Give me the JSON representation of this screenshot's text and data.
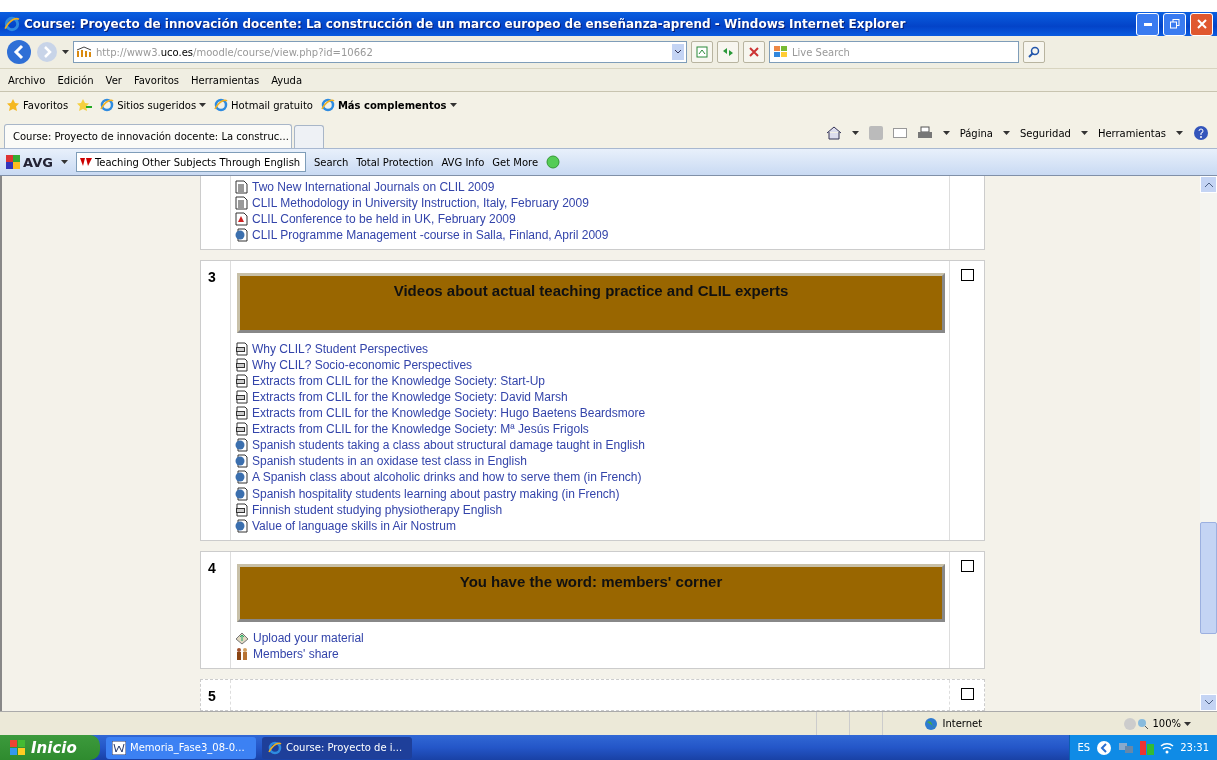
{
  "window": {
    "title": "Course: Proyecto de innovación docente: La construcción de un marco europeo de enseñanza-aprend - Windows Internet Explorer"
  },
  "address": {
    "url": "http://www3.**uco.es**/moodle/course/view.php?id=10662"
  },
  "search": {
    "placeholder": "Live Search"
  },
  "menu": [
    "Archivo",
    "Edición",
    "Ver",
    "Favoritos",
    "Herramientas",
    "Ayuda"
  ],
  "favorites_bar": {
    "label": "Favoritos",
    "items": [
      {
        "label": "Sitios sugeridos",
        "dropdown": true,
        "bold": false
      },
      {
        "label": "Hotmail gratuito",
        "dropdown": false,
        "bold": false
      },
      {
        "label": "Más complementos",
        "dropdown": true,
        "bold": true
      }
    ]
  },
  "tab": {
    "label": "Course: Proyecto de innovación docente: La construc...",
    "selected": true
  },
  "command_bar": [
    "Página",
    "Seguridad",
    "Herramientas"
  ],
  "avg_toolbar": {
    "brand": "AVG",
    "query": "Teaching Other Subjects Through English",
    "items": [
      "Search",
      "Total Protection",
      "AVG Info",
      "Get More"
    ]
  },
  "sections": [
    {
      "links": [
        {
          "text": "Two New International Journals on CLIL 2009",
          "kind": "document"
        },
        {
          "text": "CLIL Methodology in University Instruction, Italy, February 2009",
          "kind": "document"
        },
        {
          "text": "CLIL Conference to be held in UK, February 2009",
          "kind": "pdf"
        },
        {
          "text": "CLIL Programme Management -course in Salla, Finland, April 2009",
          "kind": "web"
        }
      ]
    },
    {
      "number": "3",
      "title": "Videos about actual teaching practice and CLIL experts",
      "checked": false,
      "links": [
        {
          "text": "Why CLIL? Student Perspectives",
          "kind": "video"
        },
        {
          "text": "Why CLIL? Socio-economic Perspectives",
          "kind": "video"
        },
        {
          "text": "Extracts from CLIL for the Knowledge Society: Start-Up",
          "kind": "video"
        },
        {
          "text": "Extracts from CLIL for the Knowledge Society: David Marsh",
          "kind": "video"
        },
        {
          "text": "Extracts from CLIL for the Knowledge Society: Hugo Baetens Beardsmore",
          "kind": "video"
        },
        {
          "text": "Extracts from CLIL for the Knowledge Society: Mª Jesús Frigols",
          "kind": "video"
        },
        {
          "text": "Spanish students taking a class about structural damage taught in English",
          "kind": "web"
        },
        {
          "text": "Spanish students in an oxidase test class in English",
          "kind": "web"
        },
        {
          "text": "A Spanish class about alcoholic drinks and how to serve them (in French)",
          "kind": "web"
        },
        {
          "text": "Spanish hospitality students learning about pastry making (in French)",
          "kind": "web"
        },
        {
          "text": "Finnish student studying physiotherapy English",
          "kind": "video"
        },
        {
          "text": "Value of language skills in Air Nostrum",
          "kind": "web"
        }
      ]
    },
    {
      "number": "4",
      "title": "You have the word: members' corner",
      "checked": false,
      "links": [
        {
          "text": "Upload your material",
          "kind": "upload"
        },
        {
          "text": "Members' share",
          "kind": "share"
        }
      ]
    },
    {
      "number": "5",
      "checked": false
    }
  ],
  "status_bar": {
    "zone": "Internet",
    "zoom": "100%"
  },
  "taskbar": {
    "start": "Inicio",
    "tasks": [
      {
        "label": "Memoria_Fase3_08-0...",
        "kind": "word",
        "selected": false
      },
      {
        "label": "Course: Proyecto de i...",
        "kind": "ie",
        "selected": true
      }
    ],
    "language": "ES",
    "clock": "23:31"
  }
}
